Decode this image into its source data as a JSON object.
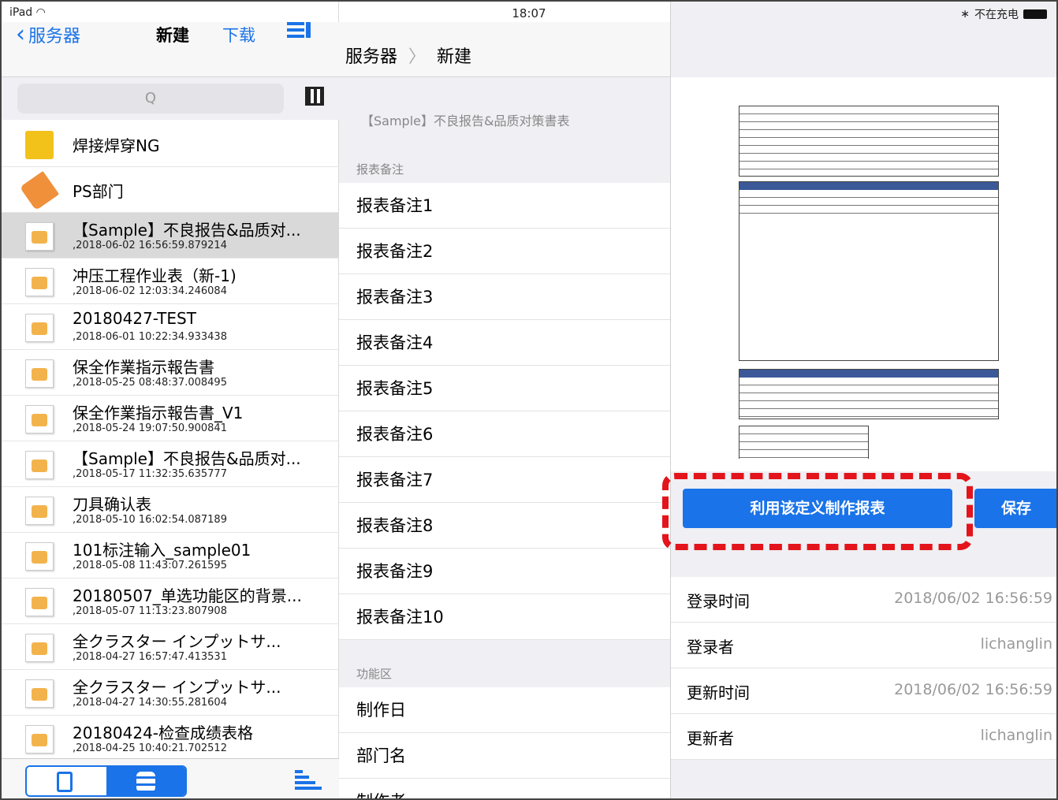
{
  "status": {
    "device": "iPad",
    "time": "18:07",
    "charge": "不在充电"
  },
  "left_nav": {
    "back": "服务器",
    "new": "新建",
    "download": "下载"
  },
  "search": {
    "placeholder": "Q"
  },
  "files": [
    {
      "name": "焊接焊穿NG",
      "date": "",
      "icon": "folder-icon"
    },
    {
      "name": "PS部门",
      "date": "",
      "icon": "tag-icon"
    },
    {
      "name": "【Sample】不良报告&品质对...",
      "date": ",2018-06-02 16:56:59.879214",
      "icon": "document-icon",
      "selected": true
    },
    {
      "name": "冲压工程作业表（新-1)",
      "date": ",2018-06-02 12:03:34.246084",
      "icon": "document-icon"
    },
    {
      "name": "20180427-TEST",
      "date": ",2018-06-01 10:22:34.933438",
      "icon": "document-icon"
    },
    {
      "name": "保全作業指示報告書",
      "date": ",2018-05-25 08:48:37.008495",
      "icon": "document-icon"
    },
    {
      "name": "保全作業指示報告書_V1",
      "date": ",2018-05-24 19:07:50.900841",
      "icon": "document-icon"
    },
    {
      "name": "【Sample】不良报告&品质对...",
      "date": ",2018-05-17 11:32:35.635777",
      "icon": "document-icon"
    },
    {
      "name": "刀具确认表",
      "date": ",2018-05-10 16:02:54.087189",
      "icon": "document-icon"
    },
    {
      "name": "101标注输入_sample01",
      "date": ",2018-05-08 11:43:07.261595",
      "icon": "document-icon"
    },
    {
      "name": "20180507_单选功能区的背景...",
      "date": ",2018-05-07 11:13:23.807908",
      "icon": "document-icon"
    },
    {
      "name": "全クラスター インプットサ...",
      "date": ",2018-04-27 16:57:47.413531",
      "icon": "document-icon"
    },
    {
      "name": "全クラスター インプットサ...",
      "date": ",2018-04-27 14:30:55.281604",
      "icon": "document-icon"
    },
    {
      "name": "20180424-检查成绩表格",
      "date": ",2018-04-25 10:40:21.702512",
      "icon": "document-icon"
    }
  ],
  "breadcrumb": {
    "root": "服务器",
    "sep": "〉",
    "current": "新建"
  },
  "middle": {
    "doc_title": "【Sample】不良报告&品质对策書表",
    "notes_header": "报表备注",
    "notes": [
      "报表备注1",
      "报表备注2",
      "报表备注3",
      "报表备注4",
      "报表备注5",
      "报表备注6",
      "报表备注7",
      "报表备注8",
      "报表备注9",
      "报表备注10"
    ],
    "func_header": "功能区",
    "funcs": [
      "制作日",
      "部门名",
      "制作者"
    ]
  },
  "right": {
    "make_button": "利用该定义制作报表",
    "save_button": "保存",
    "meta": [
      {
        "key": "登录时间",
        "value": "2018/06/02 16:56:59"
      },
      {
        "key": "登录者",
        "value": "lichanglin"
      },
      {
        "key": "更新时间",
        "value": "2018/06/02 16:56:59"
      },
      {
        "key": "更新者",
        "value": "lichanglin"
      }
    ]
  },
  "colors": {
    "accent": "#1a73e8",
    "highlight": "#e3141b"
  }
}
